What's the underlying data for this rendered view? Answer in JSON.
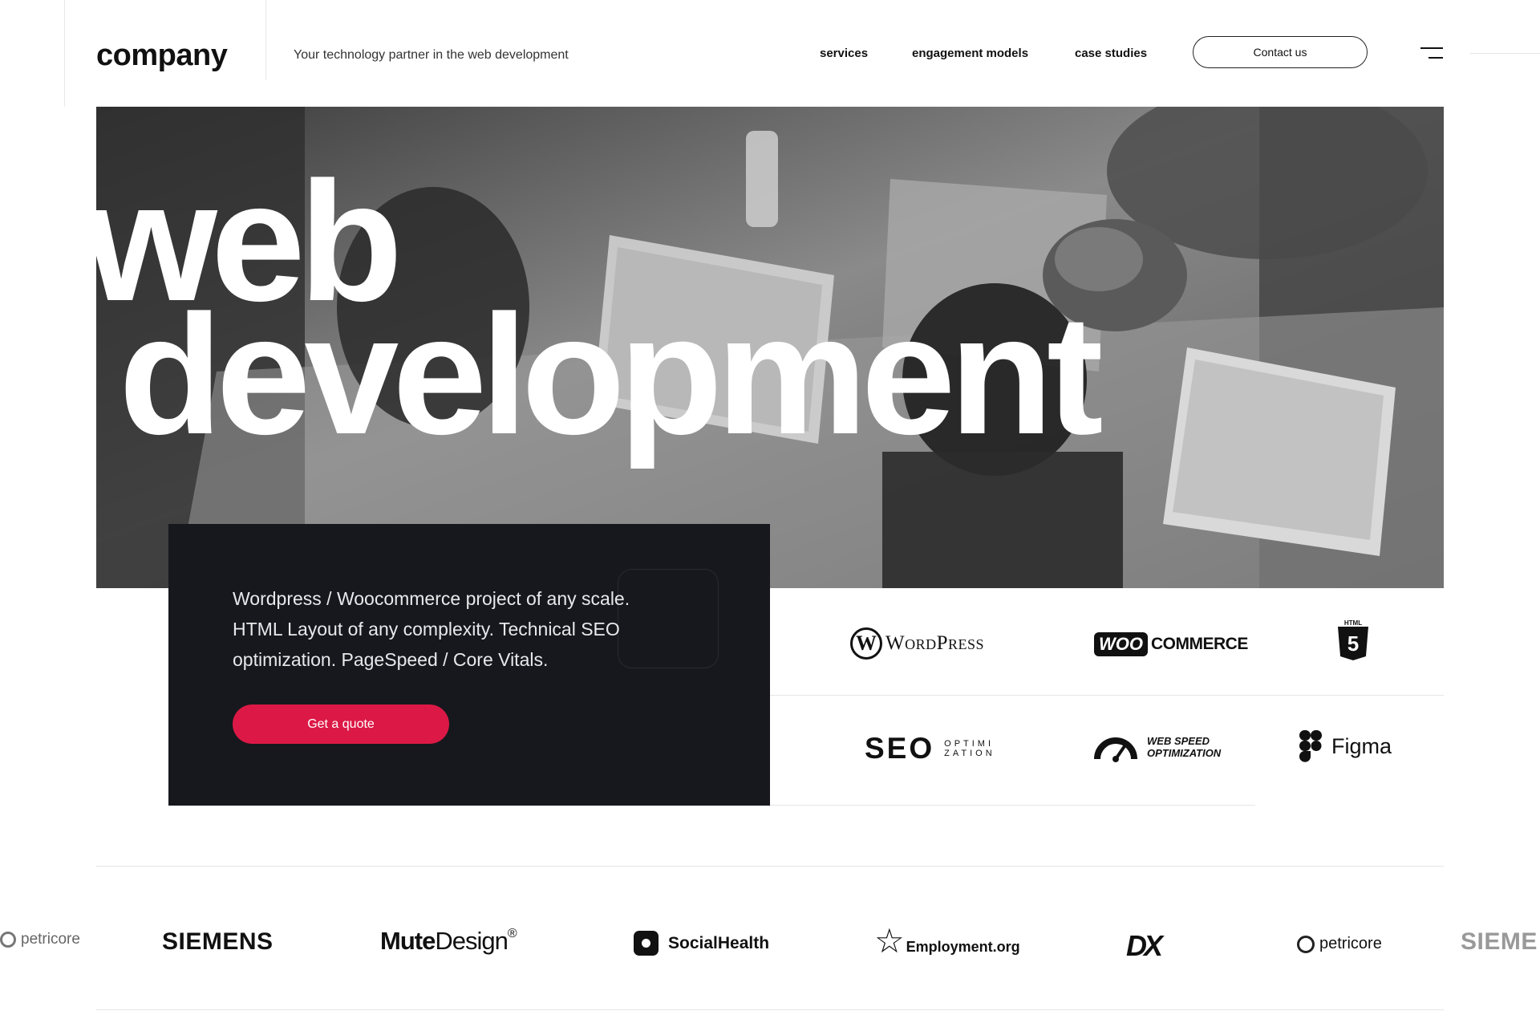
{
  "header": {
    "logo": "company",
    "tagline": "Your technology partner in the web development",
    "nav": [
      "services",
      "engagement models",
      "case studies"
    ],
    "contact_label": "Contact us"
  },
  "hero": {
    "line1": "web",
    "line2": "development"
  },
  "card": {
    "text": "Wordpress / Woocommerce project of any scale. HTML Layout of any complexity. Technical SEO optimization. PageSpeed / Core Vitals.",
    "cta_label": "Get a quote"
  },
  "technologies": {
    "wordpress": {
      "wp_mark": "W",
      "name": "WordPress"
    },
    "woocommerce": {
      "woo": "WOO",
      "commerce": "COMMERCE"
    },
    "html5": {
      "label": "HTML",
      "digit": "5"
    },
    "seo": {
      "big": "SEO",
      "small_line1": "OPTIMI",
      "small_line2": "ZATION"
    },
    "webspeed": {
      "line1": "WEB SPEED",
      "line2": "OPTIMIZATION"
    },
    "figma": {
      "name": "Figma"
    }
  },
  "clients": [
    "petricore",
    "SIEMENS",
    "Mute",
    "Design",
    "®",
    "SocialHealth",
    "Employment.org",
    "DX",
    "petricore",
    "SIEME"
  ]
}
